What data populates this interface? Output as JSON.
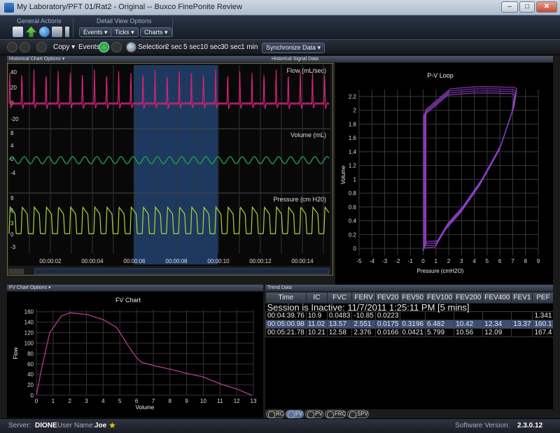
{
  "window": {
    "title": "My Laboratory/PFT 01/Rat2 - Original -- Buxco FinePonite Review",
    "buttons": {
      "minimize": "–",
      "maximize": "□",
      "close": "✕"
    }
  },
  "ribbon": {
    "general_actions_label": "General Actions",
    "detail_view_label": "Detail View Options",
    "events_label": "Events ▾",
    "ticks_label": "Ticks ▾",
    "charts_label": "Charts ▾"
  },
  "toolbar": {
    "copy_label": "Copy ▾",
    "events_label": "Events:",
    "selection_label": "Selection",
    "durations": [
      "2 sec",
      "5 sec",
      "10 sec",
      "30 sec",
      "1 min"
    ],
    "sync_label": "Synchronize Data ▾"
  },
  "historical": {
    "options_label": "Historical Chart Options ▾",
    "signal_label": "Historical Signal Data",
    "flow_title": "Flow (mL/sec)",
    "flow_ticks": [
      "40",
      "20",
      "0",
      "-20"
    ],
    "volume_title": "Volume (mL)",
    "volume_ticks": [
      "8",
      "4",
      "0",
      "-4"
    ],
    "pressure_title": "Pressure (cm H20)",
    "pressure_ticks": [
      "9",
      "6",
      "3",
      "0",
      "-3"
    ],
    "time_ticks": [
      "00:00:02",
      "00:00:04",
      "00:00:06",
      "00:00:08",
      "00:00:10",
      "00:00:12",
      "00:00:14"
    ]
  },
  "pv_chart": {
    "title": "P-V Loop",
    "xlabel": "Pressure (cmH2O)",
    "ylabel": "Volume",
    "x_ticks": [
      "-5",
      "-4",
      "-3",
      "-2",
      "-1",
      "0",
      "1",
      "2",
      "3",
      "4",
      "5",
      "6",
      "7",
      "8",
      "9"
    ],
    "y_ticks": [
      "0",
      "0.2",
      "0.4",
      "0.6",
      "0.8",
      "1",
      "1.2",
      "1.4",
      "1.6",
      "1.8",
      "2",
      "2.2"
    ]
  },
  "fv_panel": {
    "options_label": "FV Chart Options ▾"
  },
  "fv_chart": {
    "title": "FV Chart",
    "xlabel": "Volume",
    "ylabel": "Flow",
    "x_ticks": [
      "0",
      "1",
      "2",
      "3",
      "4",
      "5",
      "6",
      "7",
      "8",
      "9",
      "10",
      "11",
      "12",
      "13"
    ],
    "y_ticks": [
      "0",
      "20",
      "40",
      "60",
      "80",
      "100",
      "120",
      "140",
      "160"
    ]
  },
  "chart_data": [
    {
      "type": "line",
      "title": "P-V Loop",
      "xlabel": "Pressure (cmH2O)",
      "ylabel": "Volume",
      "xlim": [
        -5,
        9
      ],
      "ylim": [
        -0.1,
        2.3
      ],
      "series": [
        {
          "x": [
            0.1,
            0.1,
            2.0,
            4.0,
            5.5,
            7.0,
            7.2,
            7.0,
            6.0,
            4.5,
            3.0,
            1.8,
            1.0,
            0.2,
            0.0
          ],
          "y": [
            0.0,
            1.95,
            2.25,
            2.28,
            2.28,
            2.27,
            2.25,
            2.0,
            1.45,
            0.95,
            0.55,
            0.3,
            0.05,
            0.04,
            0.0
          ]
        }
      ]
    },
    {
      "type": "line",
      "title": "FV Chart",
      "xlabel": "Volume",
      "ylabel": "Flow",
      "xlim": [
        0,
        13
      ],
      "ylim": [
        0,
        165
      ],
      "series": [
        {
          "x": [
            0,
            0.3,
            0.8,
            1.5,
            2.0,
            3.0,
            4.0,
            4.8,
            5.5,
            6.0,
            6.3,
            7.0,
            8.0,
            9.0,
            10.0,
            11.0,
            12.0,
            12.9
          ],
          "y": [
            0,
            50,
            120,
            152,
            158,
            155,
            145,
            130,
            95,
            72,
            63,
            57,
            50,
            42,
            35,
            22,
            12,
            0
          ]
        }
      ]
    }
  ],
  "trend": {
    "label": "Trend Data",
    "columns": [
      "Time",
      "IC",
      "FVC",
      "FERV",
      "FEV20",
      "FEV50",
      "FEV100",
      "FEV200",
      "FEV400",
      "FEV1",
      "PEF"
    ],
    "session": "Session is Inactive: 11/7/2011 1:25:11 PM [5 mins]",
    "rows": [
      [
        "00:04:39.76",
        "10.9",
        "0.0483",
        "-10.85",
        "0.0223",
        "",
        "",
        "",
        "",
        "",
        "1.341"
      ],
      [
        "00:05:00.98",
        "11.02",
        "13.57",
        "2.551",
        "0.0175",
        "0.3196",
        "6.482",
        "10.42",
        "12.34",
        "13.37",
        "160.1"
      ],
      [
        "00:05:21.78",
        "10.21",
        "12.58",
        "2.376",
        "0.0166",
        "0.0421",
        "5.799",
        "10.56",
        "12.09",
        "",
        "167.4"
      ]
    ]
  },
  "tabs": [
    "RC",
    "FV",
    "PV",
    "FRC",
    "SPV"
  ],
  "status": {
    "server_label": "Server:",
    "server": "DIONE",
    "user_label": "User Name:",
    "user": "Joe",
    "version_label": "Software Version:",
    "version": "2.3.0.12"
  },
  "colors": {
    "flow": "#d4237a",
    "volume": "#1fa84f",
    "pressure": "#a9d63a",
    "loop": "#8f3fc4",
    "fv": "#b83a8a",
    "selection": "#22426e"
  }
}
